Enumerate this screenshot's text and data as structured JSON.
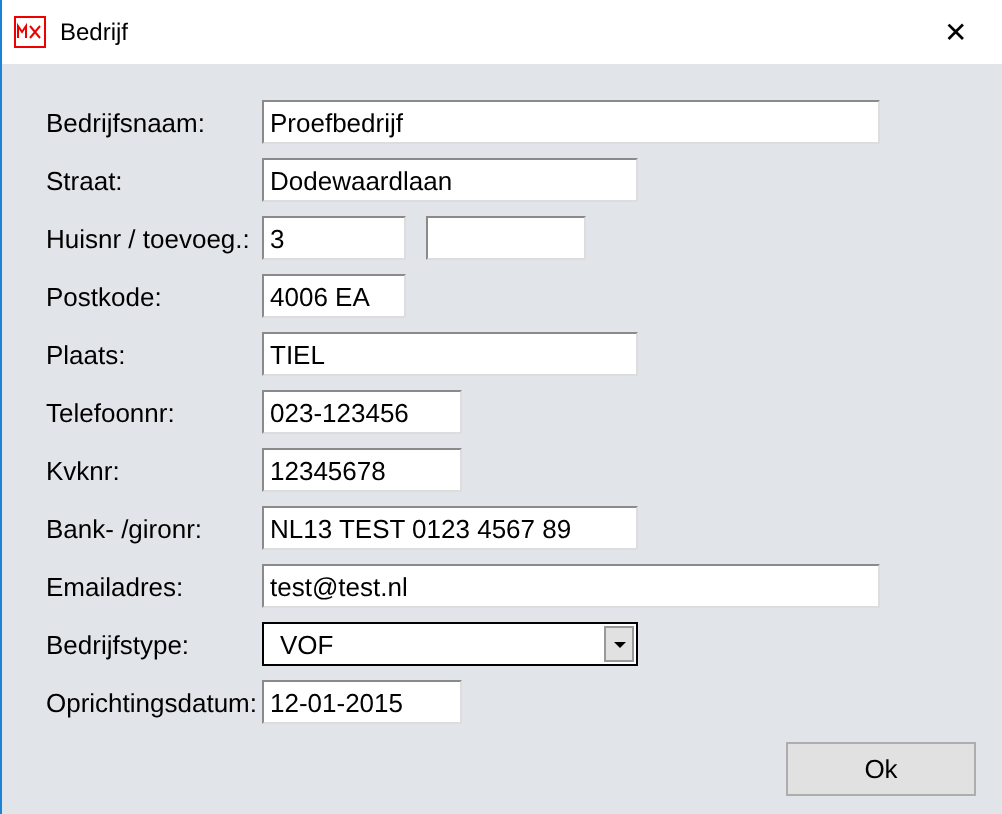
{
  "window": {
    "title": "Bedrijf",
    "close": "✕"
  },
  "rows": [
    {
      "label": "Bedrijfsnaam:",
      "kind": "text",
      "value": "Proefbedrijf"
    },
    {
      "label": "Straat:",
      "kind": "text",
      "value": "Dodewaardlaan"
    },
    {
      "label": "Huisnr / toevoeg.:",
      "kind": "split",
      "value": "3"
    },
    {
      "label": "Postkode:",
      "kind": "text",
      "value": "4006 EA"
    },
    {
      "label": "Plaats:",
      "kind": "text",
      "value": "TIEL"
    },
    {
      "label": "Telefoonnr:",
      "kind": "text",
      "value": "023-123456"
    },
    {
      "label": "Kvknr:",
      "kind": "text",
      "value": "12345678"
    },
    {
      "label": "Bank- /gironr:",
      "kind": "text",
      "value": "NL13 TEST 0123 4567 89"
    },
    {
      "label": "Emailadres:",
      "kind": "text",
      "value": "test@test.nl"
    },
    {
      "label": "Bedrijfstype:",
      "kind": "select",
      "value": "VOF"
    },
    {
      "label": "Oprichtingsdatum:",
      "kind": "text",
      "value": "12-01-2015"
    }
  ],
  "ok_button": "Ok"
}
